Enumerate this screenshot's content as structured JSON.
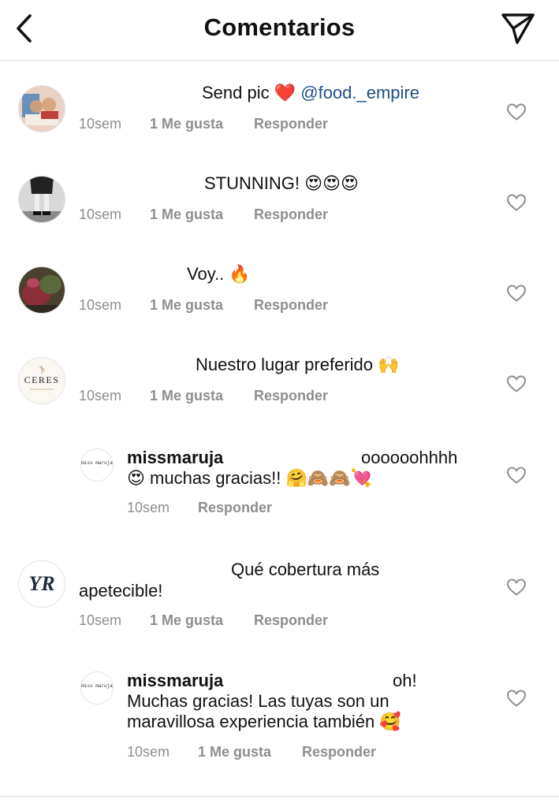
{
  "header": {
    "title": "Comentarios",
    "back_icon": "chevron-left-icon",
    "share_icon": "paper-plane-icon"
  },
  "comments": [
    {
      "text": "Send pic ❤️",
      "mention": "@food._empire",
      "time": "10sem",
      "likes": "1 Me gusta",
      "reply": "Responder"
    },
    {
      "text": "STUNNING! 😍😍😍",
      "time": "10sem",
      "likes": "1 Me gusta",
      "reply": "Responder"
    },
    {
      "text": "Voy.. 🔥",
      "time": "10sem",
      "likes": "1 Me gusta",
      "reply": "Responder"
    },
    {
      "text": "Nuestro lugar preferido 🙌",
      "avatar_text": "CERES",
      "time": "10sem",
      "likes": "1 Me gusta",
      "reply": "Responder"
    },
    {
      "username": "missmaruja",
      "line1": "oooooohhhh",
      "line2": "😍 muchas gracias!! 🤗🙈🙈💘",
      "avatar_text": "miss maruja",
      "time": "10sem",
      "reply": "Responder"
    },
    {
      "line1": "Qué cobertura más",
      "line2": "apetecible!",
      "avatar_text": "YR",
      "time": "10sem",
      "likes": "1 Me gusta",
      "reply": "Responder"
    },
    {
      "username": "missmaruja",
      "line1": "oh!",
      "line2": "Muchas gracias! Las tuyas son un",
      "line3": "maravillosa experiencia también 🥰",
      "avatar_text": "miss maruja",
      "time": "10sem",
      "likes": "1 Me gusta",
      "reply": "Responder"
    }
  ],
  "colors": {
    "meta": "#8e8e8e",
    "mention": "#1d4f86",
    "heart_like": "#ed4956",
    "divider": "#dbdbdb"
  }
}
